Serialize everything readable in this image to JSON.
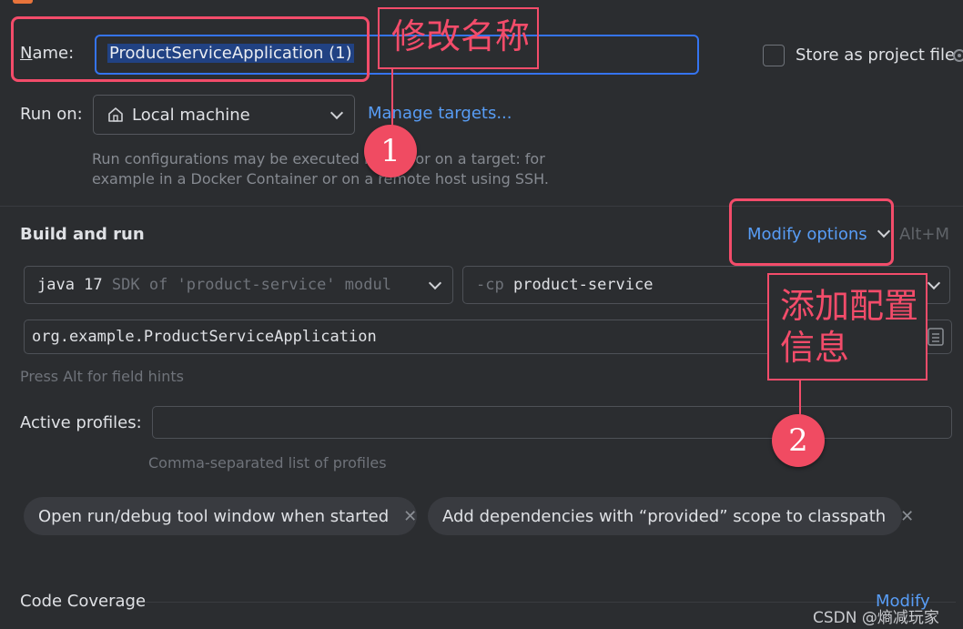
{
  "name": {
    "label": "Name:",
    "mnemonic": "N",
    "rest": "ame:",
    "value": "ProductServiceApplication (1)"
  },
  "store_project": {
    "label": "Store as project file"
  },
  "run_on": {
    "label": "Run on:",
    "selected": "Local machine",
    "manage_link": "Manage targets...",
    "help_line1": "Run configurations may be executed locally or on a target: for",
    "help_line2": "example in a Docker Container or on a remote host using SSH."
  },
  "build": {
    "heading": "Build and run",
    "modify_options": "Modify options",
    "shortcut": "Alt+M",
    "jdk_bold": "java 17",
    "jdk_dim": "SDK of 'product-service' modul",
    "cp_dim": "-cp",
    "cp_value": "product-service",
    "main_class": "org.example.ProductServiceApplication",
    "hint": "Press Alt for field hints"
  },
  "profiles": {
    "label": "Active profiles:",
    "value": "",
    "help": "Comma-separated list of profiles"
  },
  "chips": [
    {
      "label": "Open run/debug tool window when started"
    },
    {
      "label": "Add dependencies with “provided” scope to classpath"
    }
  ],
  "coverage": {
    "label": "Code Coverage",
    "modify": "Modify"
  },
  "annotations": {
    "rename_text": "修改名称",
    "step1": "1",
    "add_config_line1": "添加配置",
    "add_config_line2": "信息",
    "step2": "2"
  },
  "watermark": "CSDN @熵减玩家",
  "colors": {
    "accent": "#589df6",
    "annotation": "#f34c6a",
    "background": "#2b2d30"
  }
}
